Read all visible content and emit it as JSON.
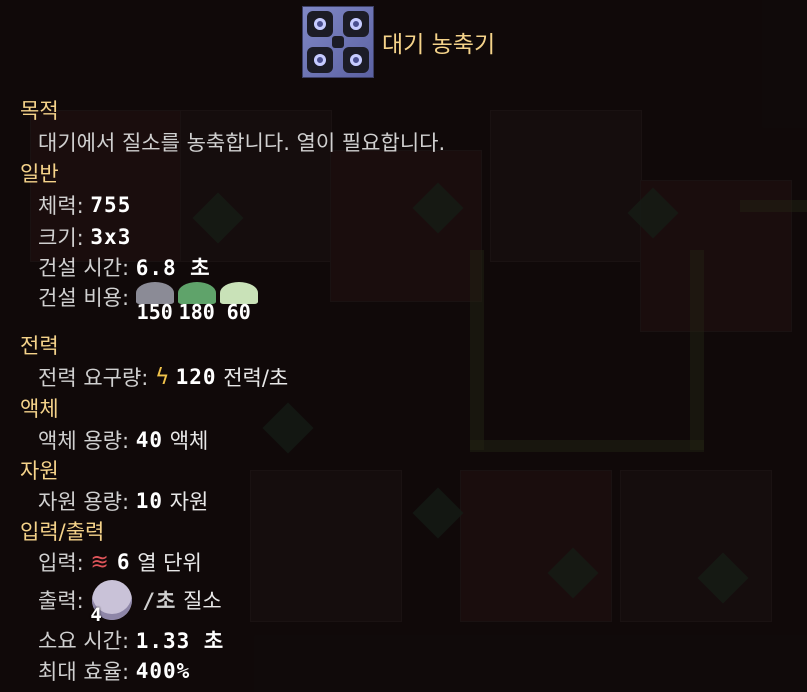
{
  "title": "대기 농축기",
  "purpose": {
    "header": "목적",
    "text": "대기에서 질소를 농축합니다. 열이 필요합니다."
  },
  "general": {
    "header": "일반",
    "health_label": "체력:",
    "health_value": "755",
    "size_label": "크기:",
    "size_value": "3x3",
    "build_time_label": "건설 시간:",
    "build_time_value": "6.8 초",
    "build_cost_label": "건설 비용:",
    "build_cost": [
      {
        "icon": "silicon-ore-icon",
        "amount": "150",
        "color": "#8b8b96"
      },
      {
        "icon": "beryllium-icon",
        "amount": "180",
        "color": "#5fa36a"
      },
      {
        "icon": "graphite-crystal-icon",
        "amount": "60",
        "color": "#c9e2b8"
      }
    ]
  },
  "power": {
    "header": "전력",
    "use_label": "전력 요구량:",
    "use_value": "120",
    "use_unit": "전력/초"
  },
  "liquids": {
    "header": "액체",
    "capacity_label": "액체 용량:",
    "capacity_value": "40",
    "capacity_unit": "액체"
  },
  "items": {
    "header": "자원",
    "capacity_label": "자원 용량:",
    "capacity_value": "10",
    "capacity_unit": "자원"
  },
  "crafting": {
    "header": "입력/출력",
    "input_label": "입력:",
    "input_amount": "6",
    "input_unit": "열 단위",
    "output_label": "출력:",
    "output_amount": "4",
    "output_rate": "/초",
    "output_item": "질소",
    "time_label": "소요 시간:",
    "time_value": "1.33 초",
    "efficiency_label": "최대 효율:",
    "efficiency_value": "400%"
  },
  "colors": {
    "section": "#f5d38a",
    "text": "#e8e8e8",
    "bolt": "#f1c34b",
    "heat": "#e0555a"
  }
}
